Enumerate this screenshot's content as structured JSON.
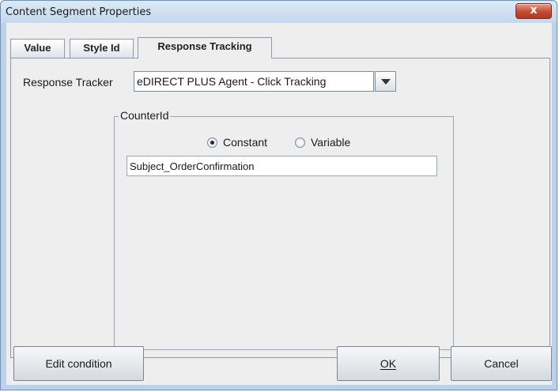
{
  "window": {
    "title": "Content Segment Properties",
    "close_glyph": "x"
  },
  "tabs": [
    {
      "label": "Value",
      "active": false
    },
    {
      "label": "Style Id",
      "active": false
    },
    {
      "label": "Response Tracking",
      "active": true
    }
  ],
  "response_tracker": {
    "label": "Response Tracker",
    "selected": "eDIRECT PLUS Agent - Click Tracking",
    "dropdown_icon": "caret-down"
  },
  "counter_group": {
    "title": "CounterId",
    "options": [
      {
        "label": "Constant",
        "checked": true
      },
      {
        "label": "Variable",
        "checked": false
      }
    ],
    "value": "Subject_OrderConfirmation"
  },
  "buttons": {
    "edit_condition": "Edit condition",
    "ok": "OK",
    "cancel": "Cancel"
  },
  "colors": {
    "window_frame": "#bcd2ea",
    "close_button": "#c24a32",
    "panel_background": "#eeeeee"
  }
}
